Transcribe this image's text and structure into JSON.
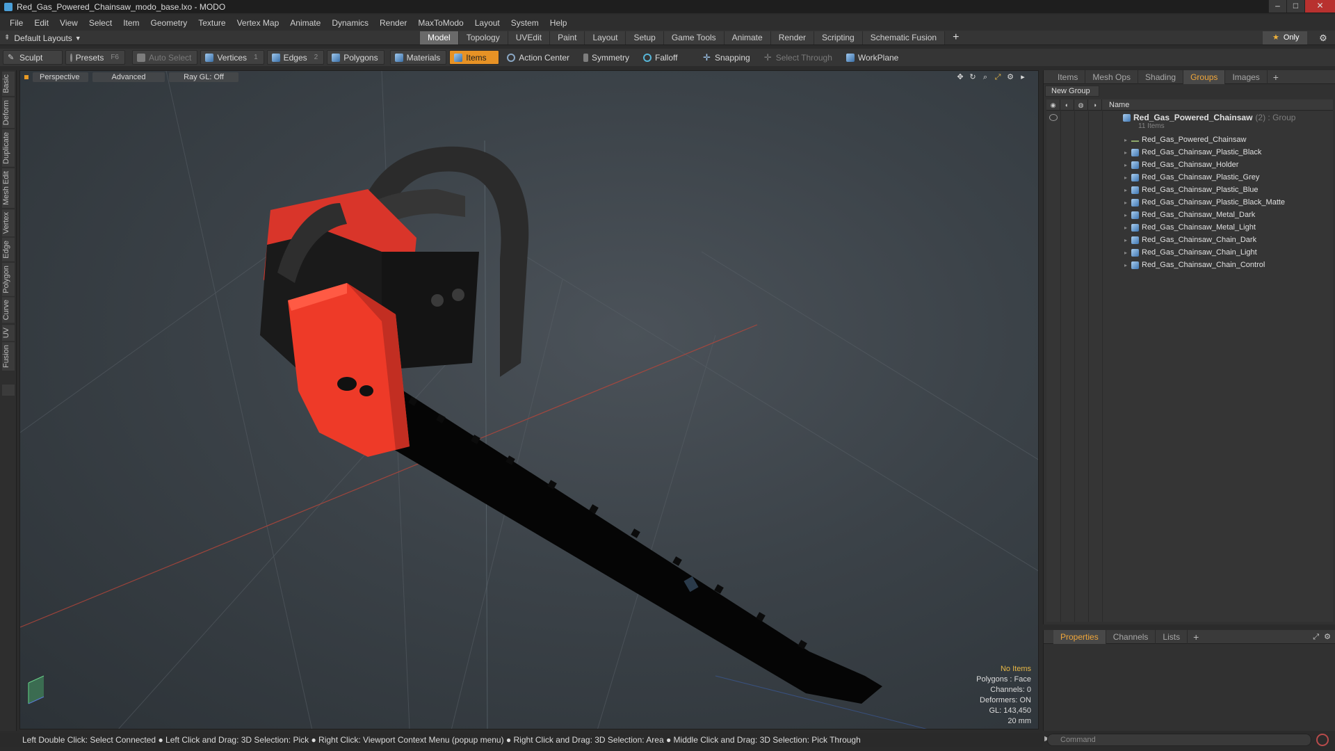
{
  "window": {
    "title": "Red_Gas_Powered_Chainsaw_modo_base.lxo - MODO",
    "controls": [
      "–",
      "□",
      "✕"
    ]
  },
  "menubar": [
    "File",
    "Edit",
    "View",
    "Select",
    "Item",
    "Geometry",
    "Texture",
    "Vertex Map",
    "Animate",
    "Dynamics",
    "Render",
    "MaxToModo",
    "Layout",
    "System",
    "Help"
  ],
  "layoutbar": {
    "layouts_label": "Default Layouts",
    "tabs": [
      "Model",
      "Topology",
      "UVEdit",
      "Paint",
      "Layout",
      "Setup",
      "Game Tools",
      "Animate",
      "Render",
      "Scripting",
      "Schematic Fusion"
    ],
    "active_tab": "Model",
    "only_label": "Only"
  },
  "toolbar": {
    "sculpt": "Sculpt",
    "presets": "Presets",
    "presets_key": "F6",
    "auto_select": "Auto Select",
    "vertices": "Vertices",
    "vertices_num": "1",
    "edges": "Edges",
    "edges_num": "2",
    "polygons": "Polygons",
    "materials": "Materials",
    "items": "Items",
    "action_center": "Action Center",
    "symmetry": "Symmetry",
    "falloff": "Falloff",
    "snapping": "Snapping",
    "select_through": "Select Through",
    "workplane": "WorkPlane"
  },
  "left_tabs": [
    "Basic",
    "Deform",
    "Duplicate",
    "Mesh Edit",
    "Vertex",
    "Edge",
    "Polygon",
    "Curve",
    "UV",
    "Fusion"
  ],
  "viewport": {
    "view": "Perspective",
    "shading": "Advanced",
    "raygl": "Ray GL: Off",
    "info": {
      "no_items": "No Items",
      "polygons": "Polygons : Face",
      "channels": "Channels: 0",
      "deformers": "Deformers: ON",
      "gl": "GL: 143,450",
      "scale": "20 mm"
    }
  },
  "groups_panel": {
    "tabs": [
      "Items",
      "Mesh Ops",
      "Shading",
      "Groups",
      "Images"
    ],
    "active_tab": "Groups",
    "new_group": "New Group",
    "name_header": "Name",
    "group_name": "Red_Gas_Powered_Chainsaw",
    "group_suffix": "(2) : Group",
    "group_count": "11 Items",
    "items": [
      "Red_Gas_Powered_Chainsaw",
      "Red_Gas_Chainsaw_Plastic_Black",
      "Red_Gas_Chainsaw_Holder",
      "Red_Gas_Chainsaw_Plastic_Grey",
      "Red_Gas_Chainsaw_Plastic_Blue",
      "Red_Gas_Chainsaw_Plastic_Black_Matte",
      "Red_Gas_Chainsaw_Metal_Dark",
      "Red_Gas_Chainsaw_Metal_Light",
      "Red_Gas_Chainsaw_Chain_Dark",
      "Red_Gas_Chainsaw_Chain_Light",
      "Red_Gas_Chainsaw_Chain_Control"
    ]
  },
  "properties_panel": {
    "tabs": [
      "Properties",
      "Channels",
      "Lists"
    ],
    "active_tab": "Properties"
  },
  "statusbar": {
    "text": "Left Double Click: Select Connected ● Left Click and Drag: 3D Selection: Pick ● Right Click: Viewport Context Menu (popup menu) ● Right Click and Drag: 3D Selection: Area ● Middle Click and Drag: 3D Selection: Pick Through"
  },
  "command": {
    "placeholder": "Command"
  },
  "colors": {
    "accent": "#e79225",
    "chainsaw_body": "#ee3a28",
    "viewport_bg": "#3b4248"
  }
}
